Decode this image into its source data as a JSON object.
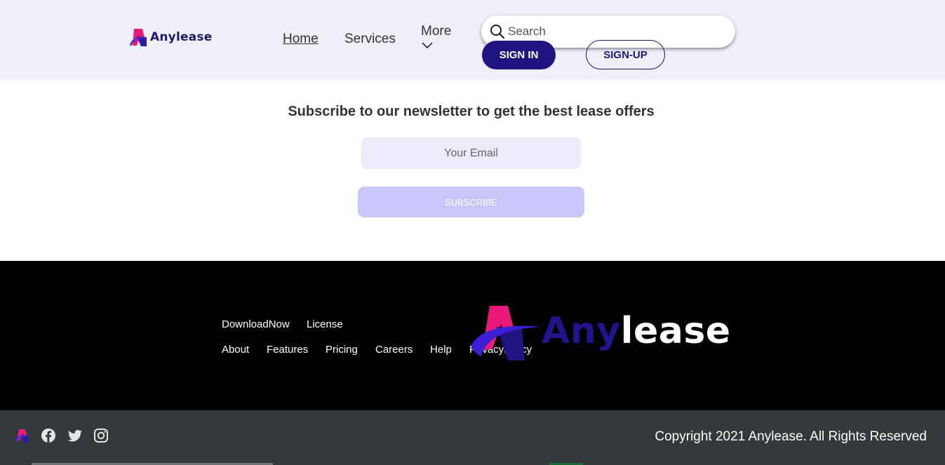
{
  "header": {
    "logo_text": "Anylease",
    "nav": {
      "home": "Home",
      "services": "Services",
      "more": "More"
    },
    "search": {
      "placeholder": "Search"
    },
    "signin_label": "SIGN IN",
    "signup_label": "SIGN-UP"
  },
  "newsletter": {
    "title": "Subscribe to our newsletter to get the best lease offers",
    "email_placeholder": "Your Email",
    "subscribe_label": "SUBSCRIBE"
  },
  "footer": {
    "links_row1": [
      "DownloadNow",
      "License"
    ],
    "links_row2": [
      "About",
      "Features",
      "Pricing",
      "Careers",
      "Help",
      "PrivacyPolicy"
    ],
    "logo_any": "Any",
    "logo_lease": "lease"
  },
  "bottombar": {
    "social_icons": [
      "anylease-logo-icon",
      "facebook-icon",
      "twitter-icon",
      "instagram-icon"
    ],
    "copyright": "Copyright 2021 Anylease. All Rights Reserved"
  },
  "colors": {
    "brand_navy": "#1f1480",
    "brand_pink": "#e8197a",
    "header_bg": "#efeffa",
    "subscribe_bg": "#c8c6fb",
    "footer_bg": "#000000",
    "bottombar_bg": "#343a3b"
  }
}
